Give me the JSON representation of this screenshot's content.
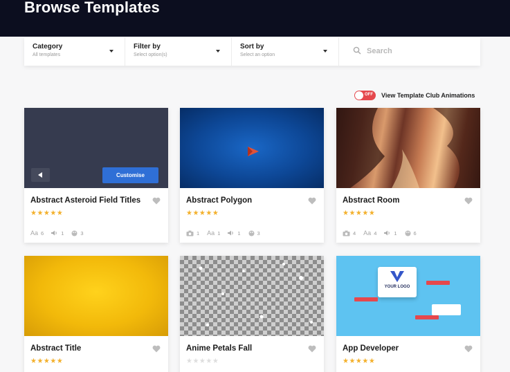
{
  "header": {
    "title": "Browse Templates"
  },
  "filters": {
    "category": {
      "label": "Category",
      "value": "All templates"
    },
    "filter_by": {
      "label": "Filter by",
      "value": "Select option(s)"
    },
    "sort_by": {
      "label": "Sort by",
      "value": "Select an option"
    },
    "search": {
      "placeholder": "Search"
    }
  },
  "toggle": {
    "state": "OFF",
    "label": "View Template Club Animations"
  },
  "cards": [
    {
      "title": "Abstract Asteroid Field Titles",
      "rating": 5,
      "fonts": "6",
      "audio": "1",
      "colors": "3",
      "customise_label": "Customise"
    },
    {
      "title": "Abstract Polygon",
      "rating": 5,
      "images": "1",
      "fonts": "1",
      "audio": "1",
      "colors": "3"
    },
    {
      "title": "Abstract Room",
      "rating": 5,
      "images": "4",
      "fonts": "4",
      "audio": "1",
      "colors": "6"
    },
    {
      "title": "Abstract Title",
      "rating": 5
    },
    {
      "title": "Anime Petals Fall",
      "rating": 0
    },
    {
      "title": "App Developer",
      "rating": 5,
      "logo_text": "YOUR LOGO"
    }
  ],
  "icons": {
    "search": "search-icon",
    "heart": "heart-icon",
    "camera": "camera-icon",
    "font": "font-icon",
    "audio": "audio-icon",
    "palette": "palette-icon",
    "back": "back-arrow-icon",
    "play": "play-icon"
  },
  "colors": {
    "header_bg": "#0c0e1f",
    "accent_blue": "#2f6fd6",
    "star": "#f3b02b",
    "toggle_off": "#e5484d"
  }
}
